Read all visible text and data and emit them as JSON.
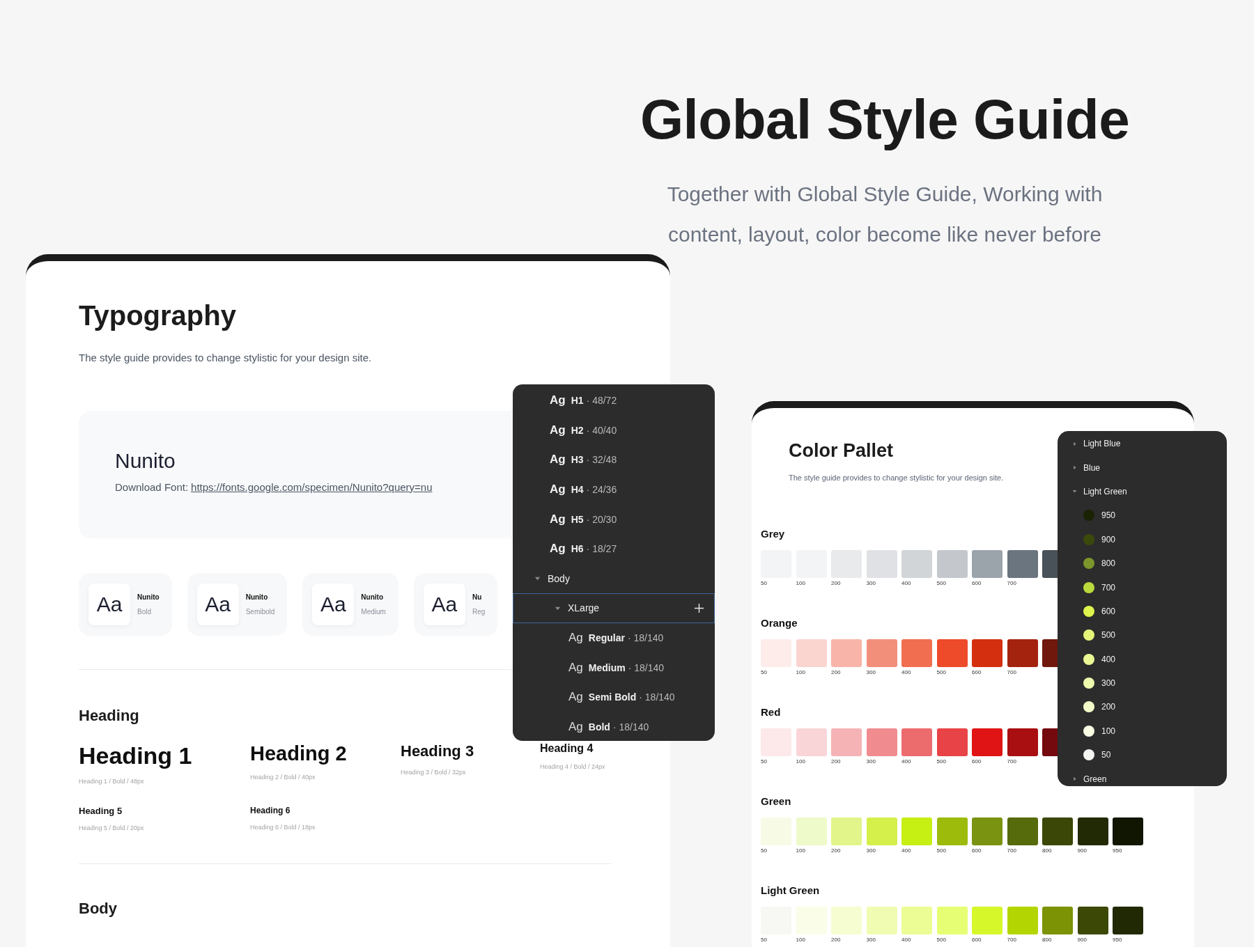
{
  "header": {
    "title": "Global Style Guide",
    "subtitle": "Together with Global Style Guide, Working with content, layout, color become like never before"
  },
  "typography_card": {
    "title": "Typography",
    "description": "The style guide provides to change stylistic for your design site.",
    "font_box": {
      "name": "Nunito",
      "download_label": "Download Font:",
      "download_url": "https://fonts.google.com/specimen/Nunito?query=nu"
    },
    "weights": [
      {
        "sample": "Aa",
        "family": "Nunito",
        "weight": "Bold"
      },
      {
        "sample": "Aa",
        "family": "Nunito",
        "weight": "Semibold"
      },
      {
        "sample": "Aa",
        "family": "Nunito",
        "weight": "Medium"
      },
      {
        "sample": "Aa",
        "family": "Nu",
        "weight": "Reg"
      }
    ],
    "heading_section": {
      "title": "Heading",
      "items": [
        {
          "kind": "h1",
          "text": "Heading 1",
          "caption": "Heading 1 / Bold / 48px"
        },
        {
          "kind": "h2",
          "text": "Heading 2",
          "caption": "Heading 2 / Bold / 40px"
        },
        {
          "kind": "h3",
          "text": "Heading 3",
          "caption": "Heading 3 / Bold / 32px"
        },
        {
          "kind": "h4",
          "text": "Heading 4",
          "caption": "Heading 4 / Bold / 24px"
        },
        {
          "kind": "h5",
          "text": "Heading 5",
          "caption": "Heading 5 / Bold / 20px"
        },
        {
          "kind": "h6",
          "text": "Heading 6",
          "caption": "Heading 6 / Bold / 18px"
        }
      ]
    },
    "body_section": {
      "title": "Body"
    }
  },
  "type_panel": {
    "rows": [
      {
        "kind": "style",
        "sample": "Ag",
        "name": "H1",
        "spec": "· 48/72",
        "selected": false
      },
      {
        "kind": "style",
        "sample": "Ag",
        "name": "H2",
        "spec": "· 40/40",
        "selected": false
      },
      {
        "kind": "style",
        "sample": "Ag",
        "name": "H3",
        "spec": "· 32/48",
        "selected": false
      },
      {
        "kind": "style",
        "sample": "Ag",
        "name": "H4",
        "spec": "· 24/36",
        "selected": false
      },
      {
        "kind": "style",
        "sample": "Ag",
        "name": "H5",
        "spec": "· 20/30",
        "selected": false
      },
      {
        "kind": "style",
        "sample": "Ag",
        "name": "H6",
        "spec": "· 18/27",
        "selected": false
      },
      {
        "kind": "group",
        "label": "Body",
        "expanded": true,
        "selected": false,
        "children": [
          {
            "kind": "group",
            "label": "XLarge",
            "expanded": true,
            "selected": true,
            "children": [
              {
                "kind": "style",
                "sample": "Ag",
                "name": "Regular",
                "spec": "· 18/140",
                "selected": false
              },
              {
                "kind": "style",
                "sample": "Ag",
                "name": "Medium",
                "spec": "· 18/140",
                "selected": false
              },
              {
                "kind": "style",
                "sample": "Ag",
                "name": "Semi Bold",
                "spec": "· 18/140",
                "selected": false
              },
              {
                "kind": "style",
                "sample": "Ag",
                "name": "Bold",
                "spec": "· 18/140",
                "selected": false
              }
            ]
          }
        ]
      }
    ]
  },
  "color_card": {
    "title": "Color Pallet",
    "description": "The style guide provides to change stylistic for your design site.",
    "palettes": [
      {
        "name": "Grey",
        "swatches": [
          {
            "label": "50",
            "color": "#f3f4f5"
          },
          {
            "label": "100",
            "color": "#f3f4f6"
          },
          {
            "label": "200",
            "color": "#e9eaeb"
          },
          {
            "label": "300",
            "color": "#dfe1e4"
          },
          {
            "label": "400",
            "color": "#d2d5d8"
          },
          {
            "label": "500",
            "color": "#c4c7cb"
          },
          {
            "label": "600",
            "color": "#9ba3ab"
          },
          {
            "label": "700",
            "color": "#6b7580"
          },
          {
            "color": "#4a5259"
          }
        ]
      },
      {
        "name": "Orange",
        "swatches": [
          {
            "label": "50",
            "color": "#fdecea"
          },
          {
            "label": "100",
            "color": "#fad5d0"
          },
          {
            "label": "200",
            "color": "#f8b4a8"
          },
          {
            "label": "300",
            "color": "#f28f7b"
          },
          {
            "label": "400",
            "color": "#f16e51"
          },
          {
            "label": "500",
            "color": "#ee4b2b"
          },
          {
            "label": "600",
            "color": "#d4300f"
          },
          {
            "label": "700",
            "color": "#a4230f"
          },
          {
            "color": "#6f180b"
          }
        ]
      },
      {
        "name": "Red",
        "swatches": [
          {
            "label": "50",
            "color": "#fde8ea"
          },
          {
            "label": "100",
            "color": "#f9d5d8"
          },
          {
            "label": "200",
            "color": "#f5b3b6"
          },
          {
            "label": "300",
            "color": "#f08b8f"
          },
          {
            "label": "400",
            "color": "#ec6b6d"
          },
          {
            "label": "500",
            "color": "#e84346"
          },
          {
            "label": "600",
            "color": "#e01414"
          },
          {
            "label": "700",
            "color": "#a90f10"
          },
          {
            "color": "#740a0e"
          }
        ]
      },
      {
        "name": "Green",
        "swatches": [
          {
            "label": "50",
            "color": "#f7fbe6"
          },
          {
            "label": "100",
            "color": "#eefac9"
          },
          {
            "label": "200",
            "color": "#e1f58a"
          },
          {
            "label": "300",
            "color": "#d5f04b"
          },
          {
            "label": "400",
            "color": "#c6ef14"
          },
          {
            "label": "500",
            "color": "#9cbb0b"
          },
          {
            "label": "600",
            "color": "#7a9311"
          },
          {
            "label": "700",
            "color": "#566b0b"
          },
          {
            "label": "800",
            "color": "#3a4707"
          },
          {
            "label": "900",
            "color": "#212a04"
          },
          {
            "label": "950",
            "color": "#111602"
          }
        ]
      },
      {
        "name": "Light Green",
        "swatches": [
          {
            "label": "50",
            "color": "#f7f7f3"
          },
          {
            "label": "100",
            "color": "#fafde8"
          },
          {
            "label": "200",
            "color": "#f6fdd1"
          },
          {
            "label": "300",
            "color": "#f0fcb1"
          },
          {
            "label": "400",
            "color": "#ebfd94"
          },
          {
            "label": "500",
            "color": "#e6fe73"
          },
          {
            "label": "600",
            "color": "#d6f729"
          },
          {
            "label": "700",
            "color": "#b3d603"
          },
          {
            "label": "800",
            "color": "#7b9305"
          },
          {
            "label": "900",
            "color": "#3b4806"
          },
          {
            "label": "950",
            "color": "#212804"
          }
        ]
      }
    ]
  },
  "color_panel": {
    "rows": [
      {
        "kind": "group",
        "label": "Light Blue",
        "expanded": false
      },
      {
        "kind": "group",
        "label": "Blue",
        "expanded": false
      },
      {
        "kind": "group",
        "label": "Light Green",
        "expanded": true,
        "children": [
          {
            "kind": "swatch",
            "label": "950",
            "color": "#1a2204"
          },
          {
            "kind": "swatch",
            "label": "900",
            "color": "#3b4a0a"
          },
          {
            "kind": "swatch",
            "label": "800",
            "color": "#7d962b"
          },
          {
            "kind": "swatch",
            "label": "700",
            "color": "#b9d93d"
          },
          {
            "kind": "swatch",
            "label": "600",
            "color": "#dff44d"
          },
          {
            "kind": "swatch",
            "label": "500",
            "color": "#e6f57a"
          },
          {
            "kind": "swatch",
            "label": "400",
            "color": "#eaf793"
          },
          {
            "kind": "swatch",
            "label": "300",
            "color": "#eefaae"
          },
          {
            "kind": "swatch",
            "label": "200",
            "color": "#f3fbc8"
          },
          {
            "kind": "swatch",
            "label": "100",
            "color": "#f9fde4"
          },
          {
            "kind": "swatch",
            "label": "50",
            "color": "#f4f4f1"
          }
        ]
      },
      {
        "kind": "group",
        "label": "Green",
        "expanded": false
      }
    ]
  }
}
